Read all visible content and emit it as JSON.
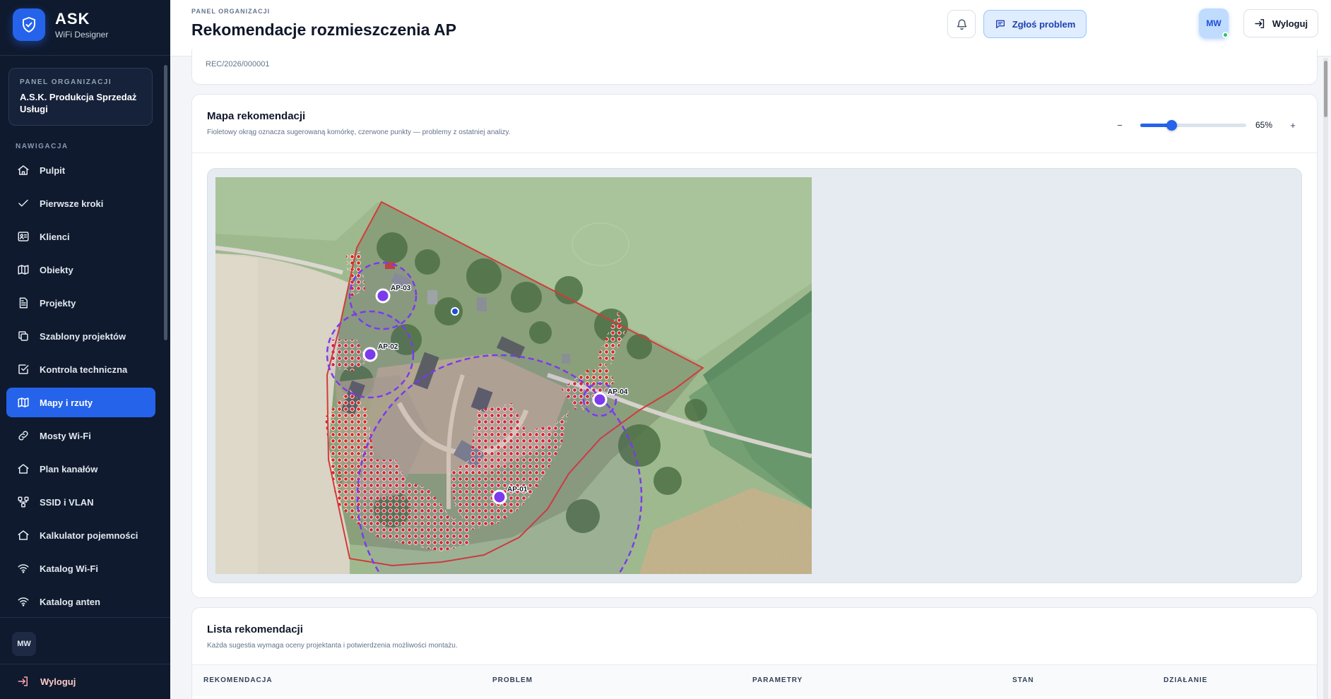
{
  "brand": {
    "name": "ASK",
    "subtitle": "WiFi Designer"
  },
  "org": {
    "label": "PANEL ORGANIZACJI",
    "name": "A.S.K. Produkcja Sprzedaż Usługi"
  },
  "nav": {
    "title": "NAWIGACJA",
    "items": [
      {
        "label": "Pulpit",
        "icon": "home-icon"
      },
      {
        "label": "Pierwsze kroki",
        "icon": "check-icon"
      },
      {
        "label": "Klienci",
        "icon": "id-card-icon"
      },
      {
        "label": "Obiekty",
        "icon": "map-icon"
      },
      {
        "label": "Projekty",
        "icon": "document-icon"
      },
      {
        "label": "Szablony projektów",
        "icon": "copy-icon"
      },
      {
        "label": "Kontrola techniczna",
        "icon": "checkbox-icon"
      },
      {
        "label": "Mapy i rzuty",
        "icon": "map-icon",
        "active": true
      },
      {
        "label": "Mosty Wi-Fi",
        "icon": "link-icon"
      },
      {
        "label": "Plan kanałów",
        "icon": "home-icon"
      },
      {
        "label": "SSID i VLAN",
        "icon": "network-icon"
      },
      {
        "label": "Kalkulator pojemności",
        "icon": "home-icon"
      },
      {
        "label": "Katalog Wi-Fi",
        "icon": "wifi-icon"
      },
      {
        "label": "Katalog anten",
        "icon": "wifi-icon"
      }
    ]
  },
  "user": {
    "initials": "MW",
    "logout_label": "Wyloguj"
  },
  "header": {
    "crumb": "PANEL ORGANIZACJI",
    "title": "Rekomendacje rozmieszczenia AP",
    "report_label": "Zgłoś problem",
    "avatar": "MW",
    "logout_label": "Wyloguj"
  },
  "summary": {
    "reference": "REC/2026/000001"
  },
  "map_card": {
    "title": "Mapa rekomendacji",
    "subtitle": "Fioletowy okrąg oznacza sugerowaną komórkę, czerwone punkty — problemy z ostatniej analizy.",
    "zoom": {
      "minus": "−",
      "plus": "+",
      "value_label": "65%",
      "value": 0.65
    },
    "access_points": [
      "AP-01",
      "AP-02",
      "AP-03",
      "AP-04"
    ],
    "colors": {
      "cell": "#7c3aed",
      "problem": "#dc2626",
      "boundary": "#d23b3b"
    }
  },
  "list_card": {
    "title": "Lista rekomendacji",
    "subtitle": "Każda sugestia wymaga oceny projektanta i potwierdzenia możliwości montażu.",
    "columns": [
      "REKOMENDACJA",
      "PROBLEM",
      "PARAMETRY",
      "STAN",
      "DZIAŁANIE"
    ]
  }
}
